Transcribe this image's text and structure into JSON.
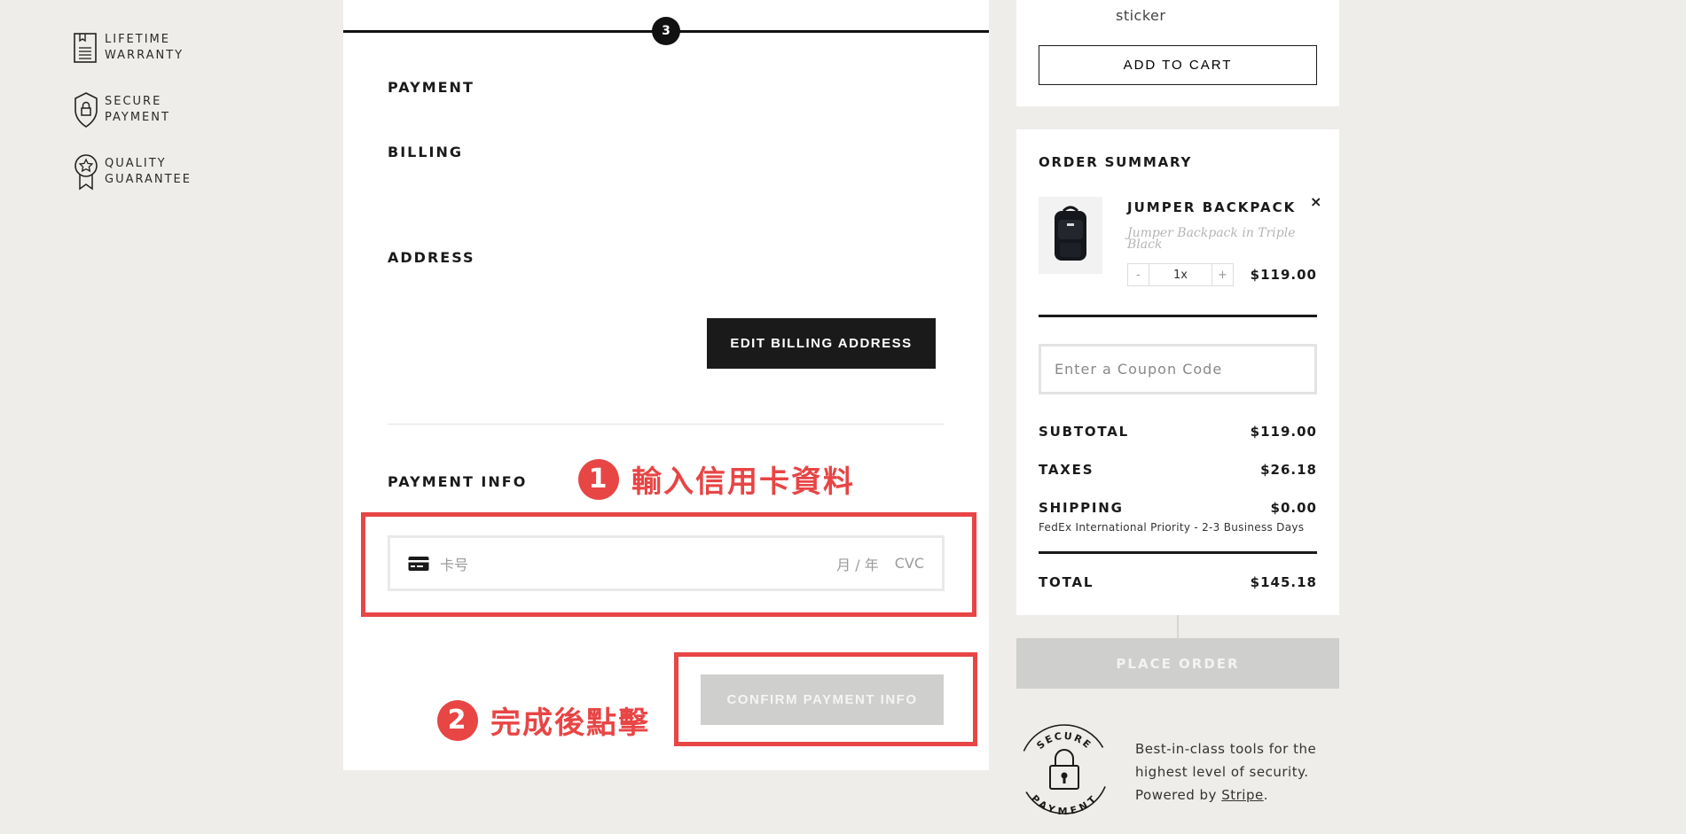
{
  "badges": [
    {
      "icon": "warranty-doc-icon",
      "line1": "LIFETIME",
      "line2": "WARRANTY"
    },
    {
      "icon": "shield-lock-icon",
      "line1": "SECURE",
      "line2": "PAYMENT"
    },
    {
      "icon": "star-ribbon-icon",
      "line1": "QUALITY",
      "line2": "GUARANTEE"
    }
  ],
  "checkout": {
    "step": "3",
    "payment_label": "PAYMENT",
    "billing_label": "BILLING",
    "address_label": "ADDRESS",
    "edit_billing_button": "EDIT BILLING ADDRESS",
    "payment_info_label": "PAYMENT INFO",
    "card_number_placeholder": "卡号",
    "card_expiry_placeholder": "月 / 年",
    "card_cvc_placeholder": "CVC",
    "confirm_button": "CONFIRM PAYMENT INFO"
  },
  "annotations": {
    "step1_number": "1",
    "step1_text": "輸入信用卡資料",
    "step2_number": "2",
    "step2_text": "完成後點擊",
    "color": "#e84545"
  },
  "upsell": {
    "caption": "sticker",
    "add_to_cart": "ADD TO CART"
  },
  "summary": {
    "title": "ORDER SUMMARY",
    "item": {
      "name": "JUMPER BACKPACK",
      "variant": "Jumper Backpack in Triple Black",
      "quantity": "1x",
      "price": "$119.00",
      "minus": "-",
      "plus": "+",
      "remove": "×"
    },
    "coupon_placeholder": "Enter a Coupon Code",
    "subtotal_label": "SUBTOTAL",
    "subtotal_value": "$119.00",
    "taxes_label": "TAXES",
    "taxes_value": "$26.18",
    "shipping_label": "SHIPPING",
    "shipping_value": "$0.00",
    "shipping_method": "FedEx International Priority - 2-3 Business Days",
    "total_label": "TOTAL",
    "total_value": "$145.18",
    "place_order": "PLACE ORDER"
  },
  "security": {
    "seal_top": "SECURE",
    "seal_bottom": "PAYMENT",
    "line1": "Best-in-class tools for the",
    "line2": "highest level of security.",
    "powered_prefix": "Powered by ",
    "powered_link": "Stripe",
    "powered_suffix": "."
  }
}
